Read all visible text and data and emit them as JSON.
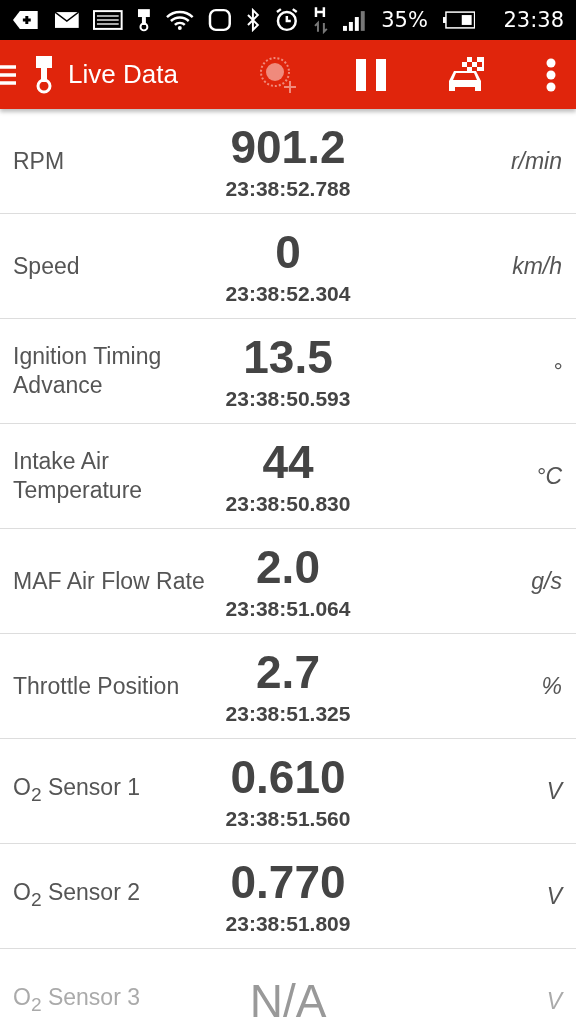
{
  "status_bar": {
    "battery": "35%",
    "time": "23:38"
  },
  "toolbar": {
    "title": "Live Data"
  },
  "rows": [
    {
      "name": "RPM",
      "value": "901.2",
      "time": "23:38:52.788",
      "unit": "r/min",
      "disabled": false
    },
    {
      "name": "Speed",
      "value": "0",
      "time": "23:38:52.304",
      "unit": "km/h",
      "disabled": false
    },
    {
      "name": "Ignition Timing Advance",
      "value": "13.5",
      "time": "23:38:50.593",
      "unit": "°",
      "disabled": false
    },
    {
      "name": "Intake Air Temperature",
      "value": "44",
      "time": "23:38:50.830",
      "unit": "°C",
      "disabled": false
    },
    {
      "name": "MAF Air Flow Rate",
      "value": "2.0",
      "time": "23:38:51.064",
      "unit": "g/s",
      "disabled": false
    },
    {
      "name": "Throttle Position",
      "value": "2.7",
      "time": "23:38:51.325",
      "unit": "%",
      "disabled": false
    },
    {
      "name": "O$_{2}$ Sensor 1",
      "value": "0.610",
      "time": "23:38:51.560",
      "unit": "V",
      "disabled": false
    },
    {
      "name": "O$_{2}$ Sensor 2",
      "value": "0.770",
      "time": "23:38:51.809",
      "unit": "V",
      "disabled": false
    },
    {
      "name": "O$_{2}$ Sensor 3",
      "value": "N/A",
      "unit": "V",
      "disabled": true
    }
  ]
}
